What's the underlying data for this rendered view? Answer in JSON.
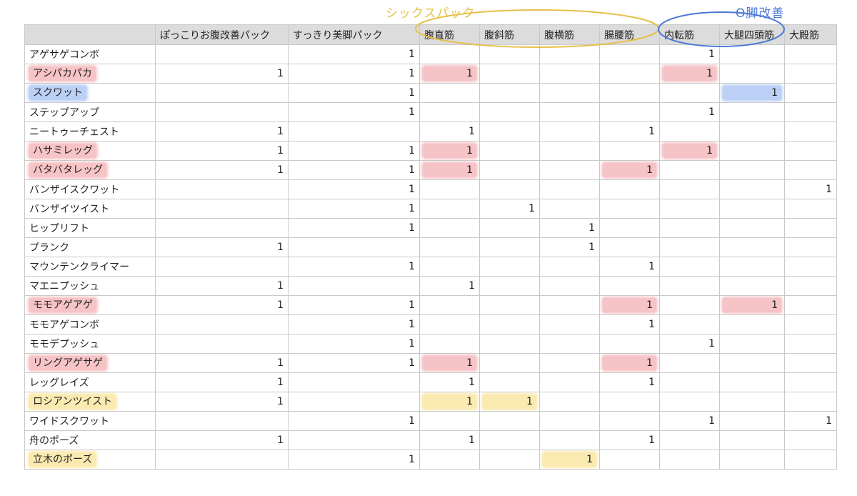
{
  "annotations": {
    "six_pack": "シックスパック",
    "leg_fix": "O脚改善"
  },
  "colors": {
    "red": "#f6c3c6",
    "blue": "#bcd0f6",
    "yellow": "#fbeab0",
    "header_bg": "#dcdcdc",
    "six_pack_ink": "#e6c04a",
    "leg_fix_ink": "#4a78d6"
  },
  "columns": [
    "",
    "ぽっこりお腹改善パック",
    "すっきり美脚パック",
    "腹直筋",
    "腹斜筋",
    "腹横筋",
    "腸腰筋",
    "内転筋",
    "大腿四頭筋",
    "大殿筋"
  ],
  "rows": [
    {
      "name": "アゲサゲコンボ",
      "values": [
        "",
        "1",
        "",
        "",
        "",
        "",
        "1",
        "",
        ""
      ]
    },
    {
      "name": "アシパカパカ",
      "name_hl": "red",
      "values": [
        "1",
        "1",
        "1",
        "",
        "",
        "",
        "1",
        "",
        ""
      ],
      "hl": {
        "2": "red",
        "6": "red"
      }
    },
    {
      "name": "スクワット",
      "name_hl": "blue",
      "values": [
        "",
        "1",
        "",
        "",
        "",
        "",
        "",
        "1",
        ""
      ],
      "hl": {
        "7": "blue"
      }
    },
    {
      "name": "ステップアップ",
      "values": [
        "",
        "1",
        "",
        "",
        "",
        "",
        "1",
        "",
        ""
      ]
    },
    {
      "name": "ニートゥーチェスト",
      "values": [
        "1",
        "",
        "1",
        "",
        "",
        "1",
        "",
        "",
        ""
      ]
    },
    {
      "name": "ハサミレッグ",
      "name_hl": "red",
      "values": [
        "1",
        "1",
        "1",
        "",
        "",
        "",
        "1",
        "",
        ""
      ],
      "hl": {
        "2": "red",
        "6": "red"
      }
    },
    {
      "name": "バタバタレッグ",
      "name_hl": "red",
      "values": [
        "1",
        "1",
        "1",
        "",
        "",
        "1",
        "",
        "",
        ""
      ],
      "hl": {
        "2": "red",
        "5": "red"
      }
    },
    {
      "name": "バンザイスクワット",
      "values": [
        "",
        "1",
        "",
        "",
        "",
        "",
        "",
        "",
        "1"
      ]
    },
    {
      "name": "バンザイツイスト",
      "values": [
        "",
        "1",
        "",
        "1",
        "",
        "",
        "",
        "",
        ""
      ]
    },
    {
      "name": "ヒップリフト",
      "values": [
        "",
        "1",
        "",
        "",
        "1",
        "",
        "",
        "",
        ""
      ]
    },
    {
      "name": "プランク",
      "values": [
        "1",
        "",
        "",
        "",
        "1",
        "",
        "",
        "",
        ""
      ]
    },
    {
      "name": "マウンテンクライマー",
      "values": [
        "",
        "1",
        "",
        "",
        "",
        "1",
        "",
        "",
        ""
      ]
    },
    {
      "name": "マエニプッシュ",
      "values": [
        "1",
        "",
        "1",
        "",
        "",
        "",
        "",
        "",
        ""
      ]
    },
    {
      "name": "モモアゲアゲ",
      "name_hl": "red",
      "values": [
        "1",
        "1",
        "",
        "",
        "",
        "1",
        "",
        "1",
        ""
      ],
      "hl": {
        "5": "red",
        "7": "red"
      }
    },
    {
      "name": "モモアゲコンボ",
      "values": [
        "",
        "1",
        "",
        "",
        "",
        "1",
        "",
        "",
        ""
      ]
    },
    {
      "name": "モモデプッシュ",
      "values": [
        "",
        "1",
        "",
        "",
        "",
        "",
        "1",
        "",
        ""
      ]
    },
    {
      "name": "リングアゲサゲ",
      "name_hl": "red",
      "values": [
        "1",
        "1",
        "1",
        "",
        "",
        "1",
        "",
        "",
        ""
      ],
      "hl": {
        "2": "red",
        "5": "red"
      }
    },
    {
      "name": "レッグレイズ",
      "values": [
        "1",
        "",
        "1",
        "",
        "",
        "1",
        "",
        "",
        ""
      ]
    },
    {
      "name": "ロシアンツイスト",
      "name_hl": "yellow",
      "values": [
        "1",
        "",
        "1",
        "1",
        "",
        "",
        "",
        "",
        ""
      ],
      "hl": {
        "2": "yellow",
        "3": "yellow"
      }
    },
    {
      "name": "ワイドスクワット",
      "values": [
        "",
        "1",
        "",
        "",
        "",
        "",
        "1",
        "",
        "1"
      ]
    },
    {
      "name": "舟のポーズ",
      "values": [
        "1",
        "",
        "1",
        "",
        "",
        "1",
        "",
        "",
        ""
      ]
    },
    {
      "name": "立木のポーズ",
      "name_hl": "yellow",
      "values": [
        "",
        "1",
        "",
        "",
        "1",
        "",
        "",
        "",
        ""
      ],
      "hl": {
        "4": "yellow"
      }
    }
  ]
}
